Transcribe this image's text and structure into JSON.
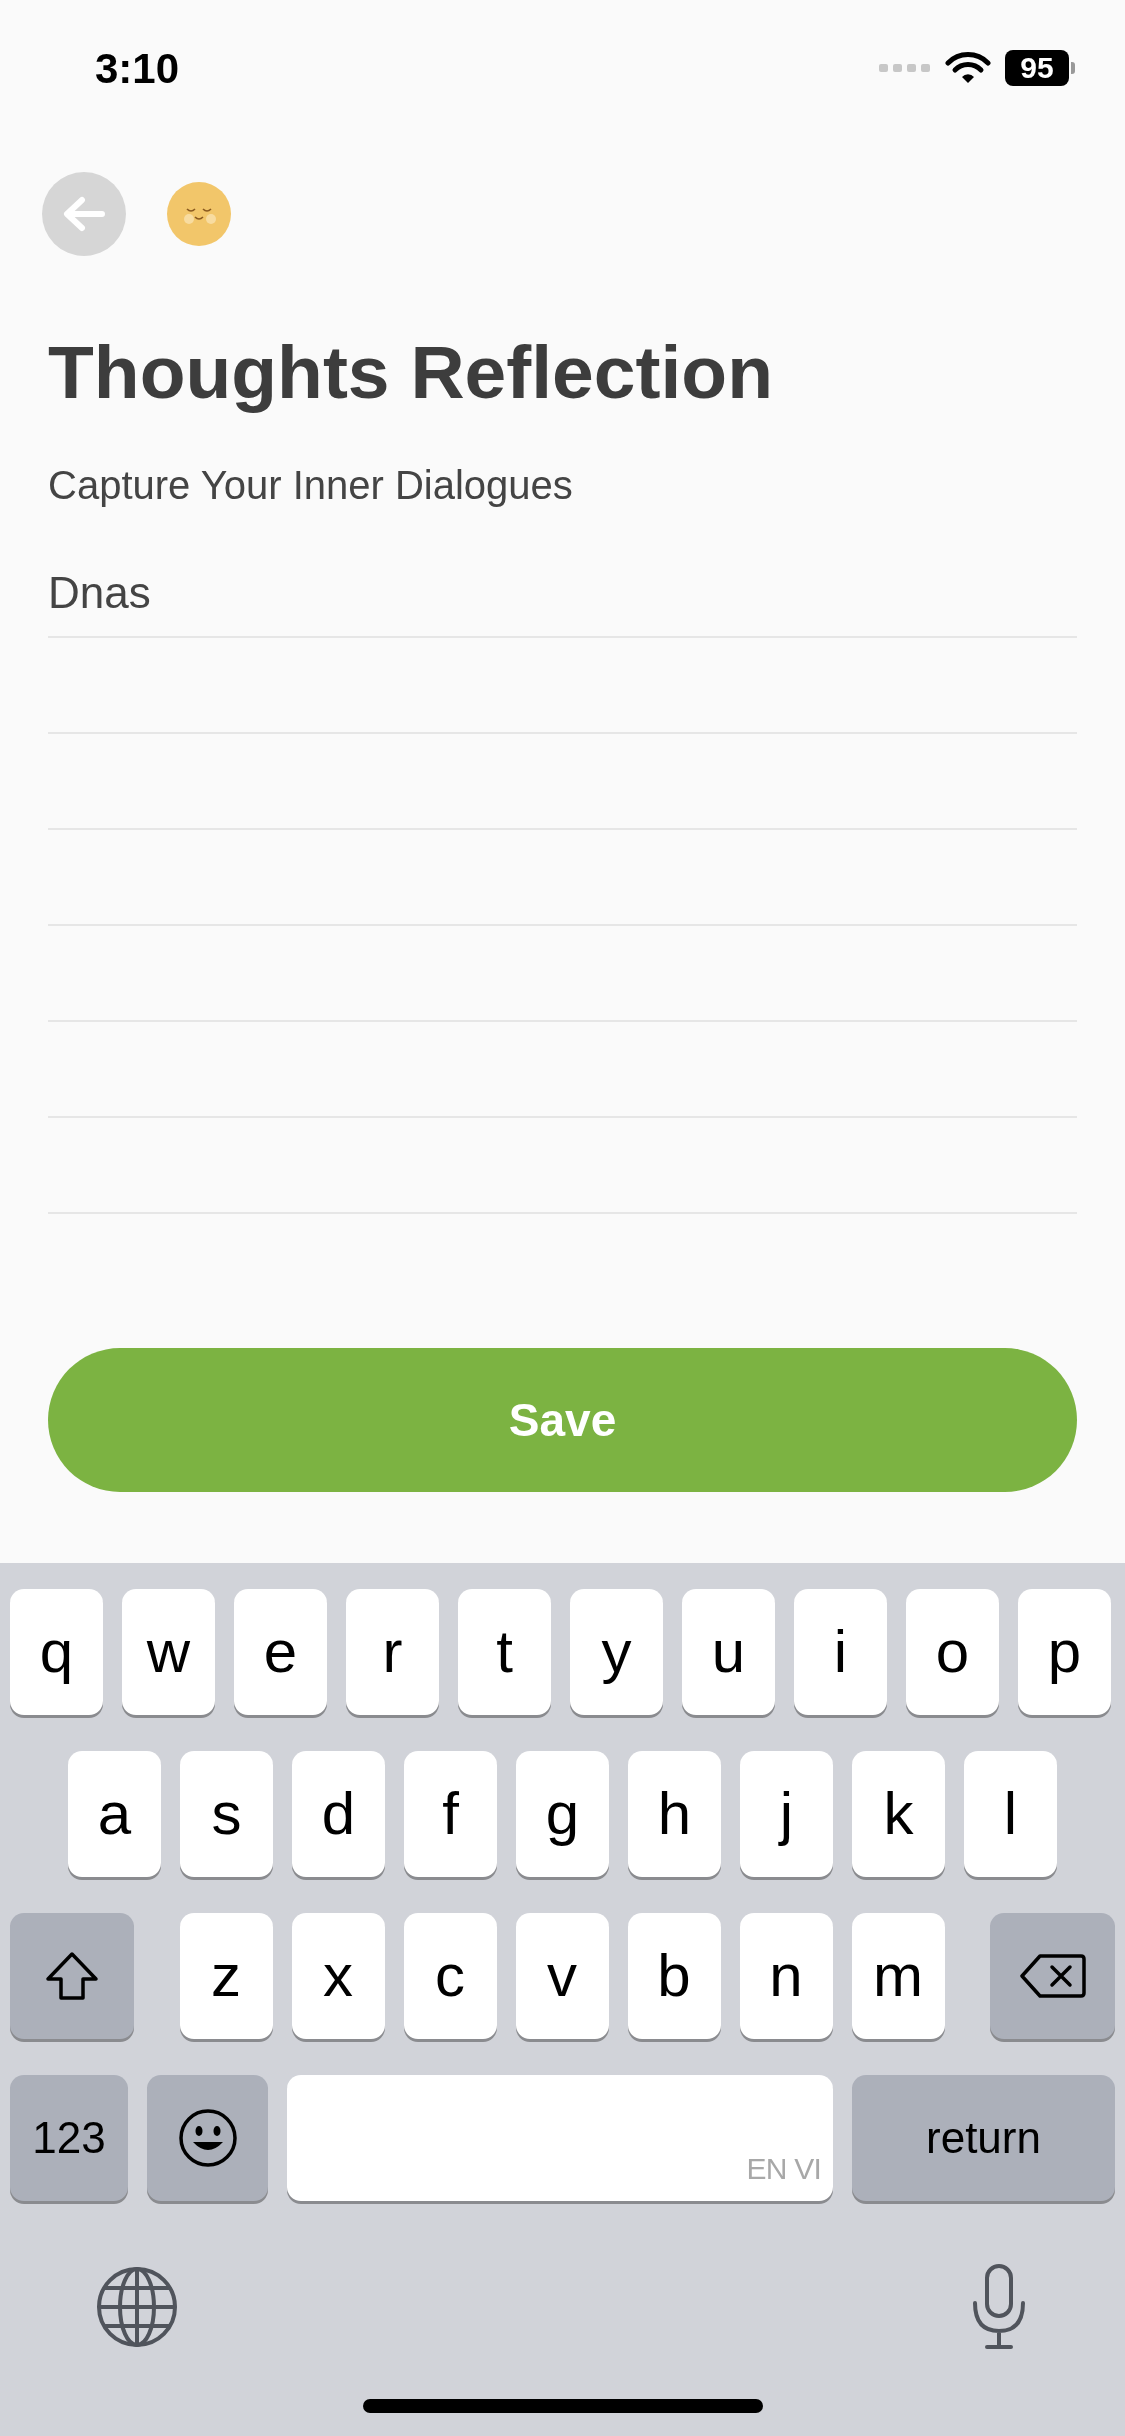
{
  "status_bar": {
    "time": "3:10",
    "battery": "95"
  },
  "header": {
    "title": "Thoughts Reflection",
    "subtitle": "Capture Your Inner Dialogues"
  },
  "entry": {
    "value": "Dnas"
  },
  "save_button": {
    "label": "Save"
  },
  "keyboard": {
    "rows": [
      {
        "keys": [
          {
            "kind": "letter",
            "label": "q"
          },
          {
            "kind": "letter",
            "label": "w"
          },
          {
            "kind": "letter",
            "label": "e"
          },
          {
            "kind": "letter",
            "label": "r"
          },
          {
            "kind": "letter",
            "label": "t"
          },
          {
            "kind": "letter",
            "label": "y"
          },
          {
            "kind": "letter",
            "label": "u"
          },
          {
            "kind": "letter",
            "label": "i"
          },
          {
            "kind": "letter",
            "label": "o"
          },
          {
            "kind": "letter",
            "label": "p"
          }
        ]
      },
      {
        "keys": [
          {
            "kind": "letter",
            "label": "a"
          },
          {
            "kind": "letter",
            "label": "s"
          },
          {
            "kind": "letter",
            "label": "d"
          },
          {
            "kind": "letter",
            "label": "f"
          },
          {
            "kind": "letter",
            "label": "g"
          },
          {
            "kind": "letter",
            "label": "h"
          },
          {
            "kind": "letter",
            "label": "j"
          },
          {
            "kind": "letter",
            "label": "k"
          },
          {
            "kind": "letter",
            "label": "l"
          }
        ]
      },
      {
        "keys": [
          {
            "kind": "shift"
          },
          {
            "kind": "letter",
            "label": "z"
          },
          {
            "kind": "letter",
            "label": "x"
          },
          {
            "kind": "letter",
            "label": "c"
          },
          {
            "kind": "letter",
            "label": "v"
          },
          {
            "kind": "letter",
            "label": "b"
          },
          {
            "kind": "letter",
            "label": "n"
          },
          {
            "kind": "letter",
            "label": "m"
          },
          {
            "kind": "delete"
          }
        ]
      },
      {
        "keys": [
          {
            "kind": "numbers",
            "label": "123"
          },
          {
            "kind": "emoji"
          },
          {
            "kind": "space",
            "label": "EN VI"
          },
          {
            "kind": "return",
            "label": "return"
          }
        ]
      }
    ]
  }
}
